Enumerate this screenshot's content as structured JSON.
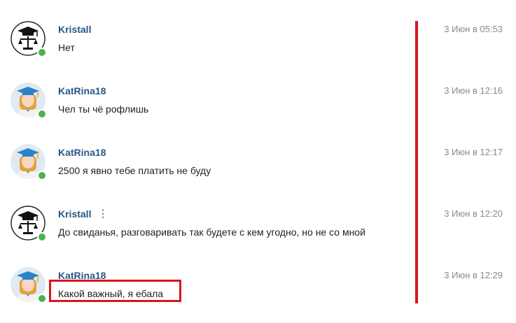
{
  "messages": [
    {
      "author": "Kristall",
      "text": "Нет",
      "time": "3 Июн в 05:53",
      "avatar": "kristall-avatar",
      "more": ""
    },
    {
      "author": "KatRina18",
      "text": "Чел ты чё рофлишь",
      "time": "3 Июн в 12:16",
      "avatar": "katrina-avatar",
      "more": ""
    },
    {
      "author": "KatRina18",
      "text": "2500 я явно тебе платить не буду",
      "time": "3 Июн в 12:17",
      "avatar": "katrina-avatar",
      "more": ""
    },
    {
      "author": "Kristall",
      "text": "До свиданья, разговаривать так будете с кем угодно, но не со мной",
      "time": "3 Июн в 12:20",
      "avatar": "kristall-avatar",
      "more": "⋮"
    },
    {
      "author": "KatRina18",
      "text": "Какой важный, я ебала",
      "time": "3 Июн в 12:29",
      "avatar": "katrina-avatar",
      "more": ""
    }
  ],
  "colors": {
    "author": "#2a5885",
    "online": "#4bb34b",
    "highlight": "#d8151f",
    "time": "#818c99"
  }
}
